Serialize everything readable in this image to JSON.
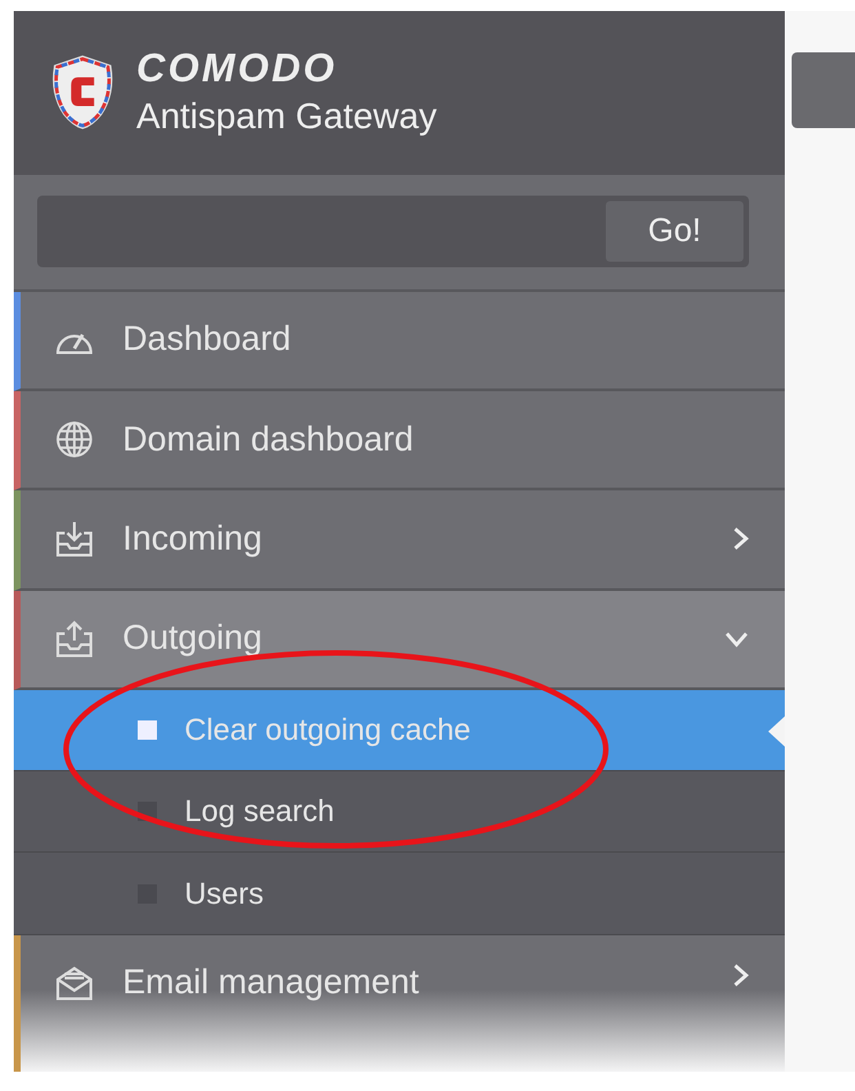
{
  "brand": {
    "name": "COMODO",
    "product": "Antispam Gateway"
  },
  "search": {
    "button": "Go!"
  },
  "menu": [
    {
      "kind": "main",
      "label": "Dashboard",
      "color": "#5b8de0",
      "expandable": false
    },
    {
      "kind": "main",
      "label": "Domain dashboard",
      "color": "#c86464",
      "expandable": false
    },
    {
      "kind": "main",
      "label": "Incoming",
      "color": "#7d9460",
      "expandable": true,
      "expanded": false
    },
    {
      "kind": "main",
      "label": "Outgoing",
      "color": "#b85a5a",
      "expandable": true,
      "expanded": true
    },
    {
      "kind": "sub",
      "label": "Clear outgoing cache",
      "selected": true
    },
    {
      "kind": "sub",
      "label": "Log search",
      "selected": false
    },
    {
      "kind": "sub",
      "label": "Users",
      "selected": false
    },
    {
      "kind": "main",
      "label": "Email management",
      "color": "#c8964a",
      "expandable": true,
      "expanded": false
    }
  ]
}
